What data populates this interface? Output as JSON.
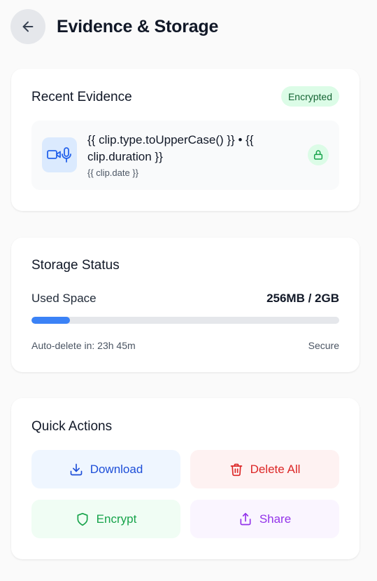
{
  "header": {
    "title": "Evidence & Storage"
  },
  "evidence": {
    "title": "Recent Evidence",
    "badge": "Encrypted",
    "clip": {
      "title": "{{ clip.type.toUpperCase() }} • {{ clip.duration }}",
      "date": "{{ clip.date }}"
    }
  },
  "storage": {
    "title": "Storage Status",
    "used_label": "Used Space",
    "used_value": "256MB / 2GB",
    "used_fraction": 0.125,
    "autodelete": "Auto-delete in: 23h 45m",
    "secure": "Secure"
  },
  "actions": {
    "title": "Quick Actions",
    "download": "Download",
    "delete_all": "Delete All",
    "encrypt": "Encrypt",
    "share": "Share"
  },
  "colors": {
    "accent_blue": "#3b82f6",
    "success_green": "#16a34a",
    "danger_red": "#dc2626",
    "purple": "#9333ea"
  },
  "icons": {
    "back": "arrow-left-icon",
    "clip": "video-mic-icon",
    "lock": "lock-icon",
    "download": "download-icon",
    "delete": "trash-icon",
    "encrypt": "shield-icon",
    "share": "share-icon"
  }
}
